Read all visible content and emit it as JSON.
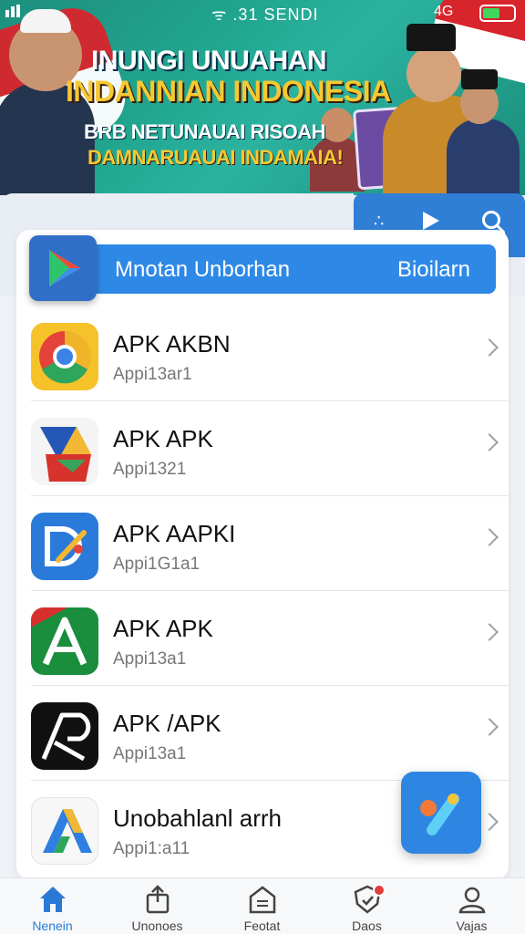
{
  "status_bar": {
    "time": "ᯤ .31 SENDI",
    "network": "4G",
    "battery_level": 0.55
  },
  "banner": {
    "line1": "INUNGI UNUAHAN",
    "line2": "INDANNIAN INDONESIA",
    "line3": "BRB NETUNAUAI RISOAH",
    "line4": "DAMNARUAUAI INDAMAIA!"
  },
  "hero": {
    "title": "Mnotan Unborhan",
    "link": "Bioilarn"
  },
  "apps": [
    {
      "title": "APK AKBN",
      "subtitle": "Appi13ar1",
      "icon": "chrome-like-icon"
    },
    {
      "title": "APK APK",
      "subtitle": "Appi1321",
      "icon": "colorful-triangle-icon"
    },
    {
      "title": "APK AAPKI",
      "subtitle": "Appi1G1a1",
      "icon": "blue-pen-icon"
    },
    {
      "title": "APK APK",
      "subtitle": "Appi13a1",
      "icon": "green-a-icon"
    },
    {
      "title": "APK /APK",
      "subtitle": "Appi13a1",
      "icon": "black-a-icon"
    },
    {
      "title": "Unobahlanl arrh",
      "subtitle": "Appi1:a11",
      "icon": "gradient-a-icon"
    }
  ],
  "nav": [
    {
      "label": "Nenein",
      "icon": "home-icon",
      "active": true
    },
    {
      "label": "Unonoes",
      "icon": "share-icon",
      "active": false
    },
    {
      "label": "Feotat",
      "icon": "document-icon",
      "active": false
    },
    {
      "label": "Daos",
      "icon": "shield-icon",
      "active": false
    },
    {
      "label": "Vajas",
      "icon": "user-icon",
      "active": false
    }
  ],
  "colors": {
    "accent": "#2e89e6",
    "banner_teal": "#21a58f",
    "badge_red": "#e23b3b"
  }
}
